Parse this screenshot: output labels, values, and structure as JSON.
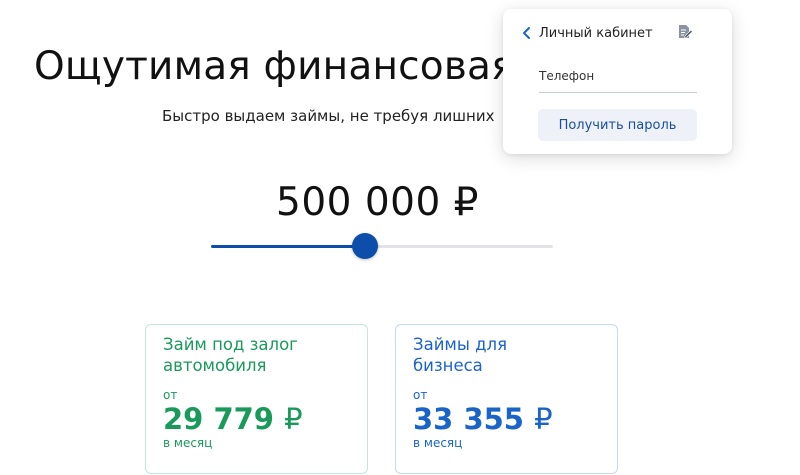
{
  "hero": {
    "title": "Ощутимая финансовая",
    "subtitle": "Быстро выдаем займы, не требуя лишних"
  },
  "calculator": {
    "amount": "500 000 ₽",
    "slider_fraction": 0.45
  },
  "cards": [
    {
      "title_line1": "Займ под залог",
      "title_line2": "автомобиля",
      "from_label": "от",
      "value": "29 779",
      "currency": "₽",
      "per_label": "в месяц",
      "accent_color": "#1a9a5a"
    },
    {
      "title_line1": "Займы для",
      "title_line2": "бизнеса",
      "from_label": "от",
      "value": "33 355",
      "currency": "₽",
      "per_label": "в месяц",
      "accent_color": "#1a63c9"
    }
  ],
  "popup": {
    "title": "Личный кабинет",
    "back_icon": "chevron-left-icon",
    "edit_icon": "edit-document-icon",
    "phone_label": "Телефон",
    "phone_value": "",
    "button_label": "Получить пароль"
  },
  "colors": {
    "primary": "#0d4eaa",
    "green": "#1a9a5a",
    "blue": "#1a63c9"
  }
}
